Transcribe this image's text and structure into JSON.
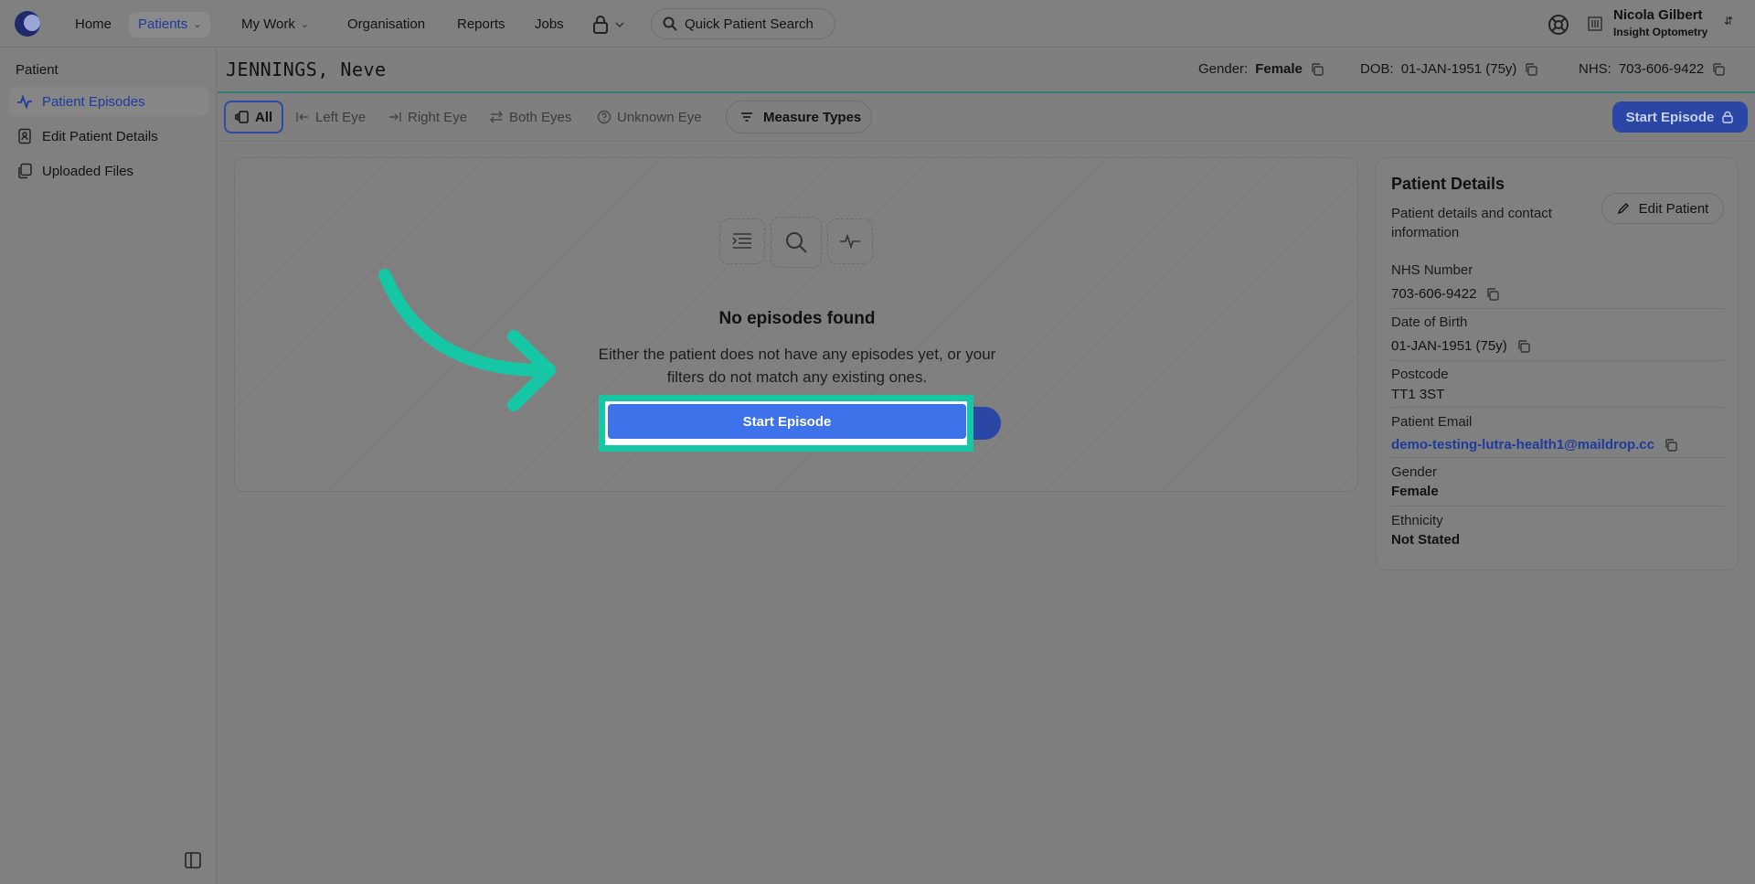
{
  "nav": {
    "home": "Home",
    "patients": "Patients",
    "my_work": "My Work",
    "organisation": "Organisation",
    "reports": "Reports",
    "jobs": "Jobs",
    "search": "Quick Patient Search"
  },
  "user": {
    "name": "Nicola Gilbert",
    "org": "Insight Optometry"
  },
  "sidebar": {
    "title": "Patient",
    "items": [
      {
        "label": "Patient Episodes"
      },
      {
        "label": "Edit Patient Details"
      },
      {
        "label": "Uploaded Files"
      }
    ]
  },
  "patient": {
    "name": "JENNINGS, Neve",
    "gender_label": "Gender:",
    "gender": "Female",
    "dob_label": "DOB:",
    "dob": "01-JAN-1951 (75y)",
    "nhs_label": "NHS:",
    "nhs": "703-606-9422"
  },
  "filters": {
    "all": "All",
    "left": "Left Eye",
    "right": "Right Eye",
    "both": "Both Eyes",
    "unknown": "Unknown Eye",
    "measure": "Measure Types",
    "start": "Start Episode"
  },
  "empty": {
    "title": "No episodes found",
    "desc": "Either the patient does not have any episodes yet, or your filters do not match any existing ones.",
    "cta": "Start Episode"
  },
  "details": {
    "title": "Patient Details",
    "subtitle": "Patient details and contact information",
    "edit": "Edit Patient",
    "nhs_label": "NHS Number",
    "nhs": "703-606-9422",
    "dob_label": "Date of Birth",
    "dob": "01-JAN-1951 (75y)",
    "postcode_label": "Postcode",
    "postcode": "TT1 3ST",
    "email_label": "Patient Email",
    "email": "demo-testing-lutra-health1@maildrop.cc",
    "gender_label": "Gender",
    "gender": "Female",
    "ethnicity_label": "Ethnicity",
    "ethnicity": "Not Stated"
  },
  "colors": {
    "highlight": "#16c7a5",
    "primary": "#3d72ea",
    "link": "#1e3a9e"
  }
}
